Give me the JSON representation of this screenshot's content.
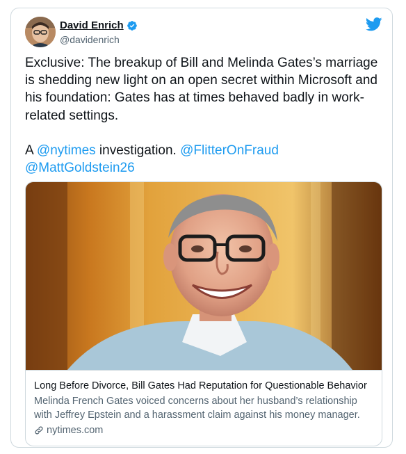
{
  "author": {
    "name": "David Enrich",
    "handle": "@davidenrich"
  },
  "tweet": {
    "text_intro": "Exclusive: The breakup of Bill and Melinda Gates’s marriage is shedding new light on an open secret within Microsoft and his foundation: Gates has at times behaved badly in work-related settings.\n\nA ",
    "mention_1": "@nytimes",
    "text_mid": " investigation. ",
    "mention_2": "@FlitterOnFraud",
    "text_space": " ",
    "mention_3": "@MattGoldstein26"
  },
  "link_card": {
    "title": "Long Before Divorce, Bill Gates Had Reputation for Questionable Behavior",
    "description": "Melinda French Gates voiced concerns about her husband’s relationship with Jeffrey Epstein and a harassment claim against his money manager.",
    "domain": "nytimes.com"
  },
  "icons": {
    "verified": "verified-badge-icon",
    "bird": "twitter-bird-icon",
    "link": "link-icon"
  },
  "colors": {
    "accent": "#1d9bf0",
    "text": "#0f1419",
    "secondary": "#536471",
    "border": "#cfd9de"
  }
}
